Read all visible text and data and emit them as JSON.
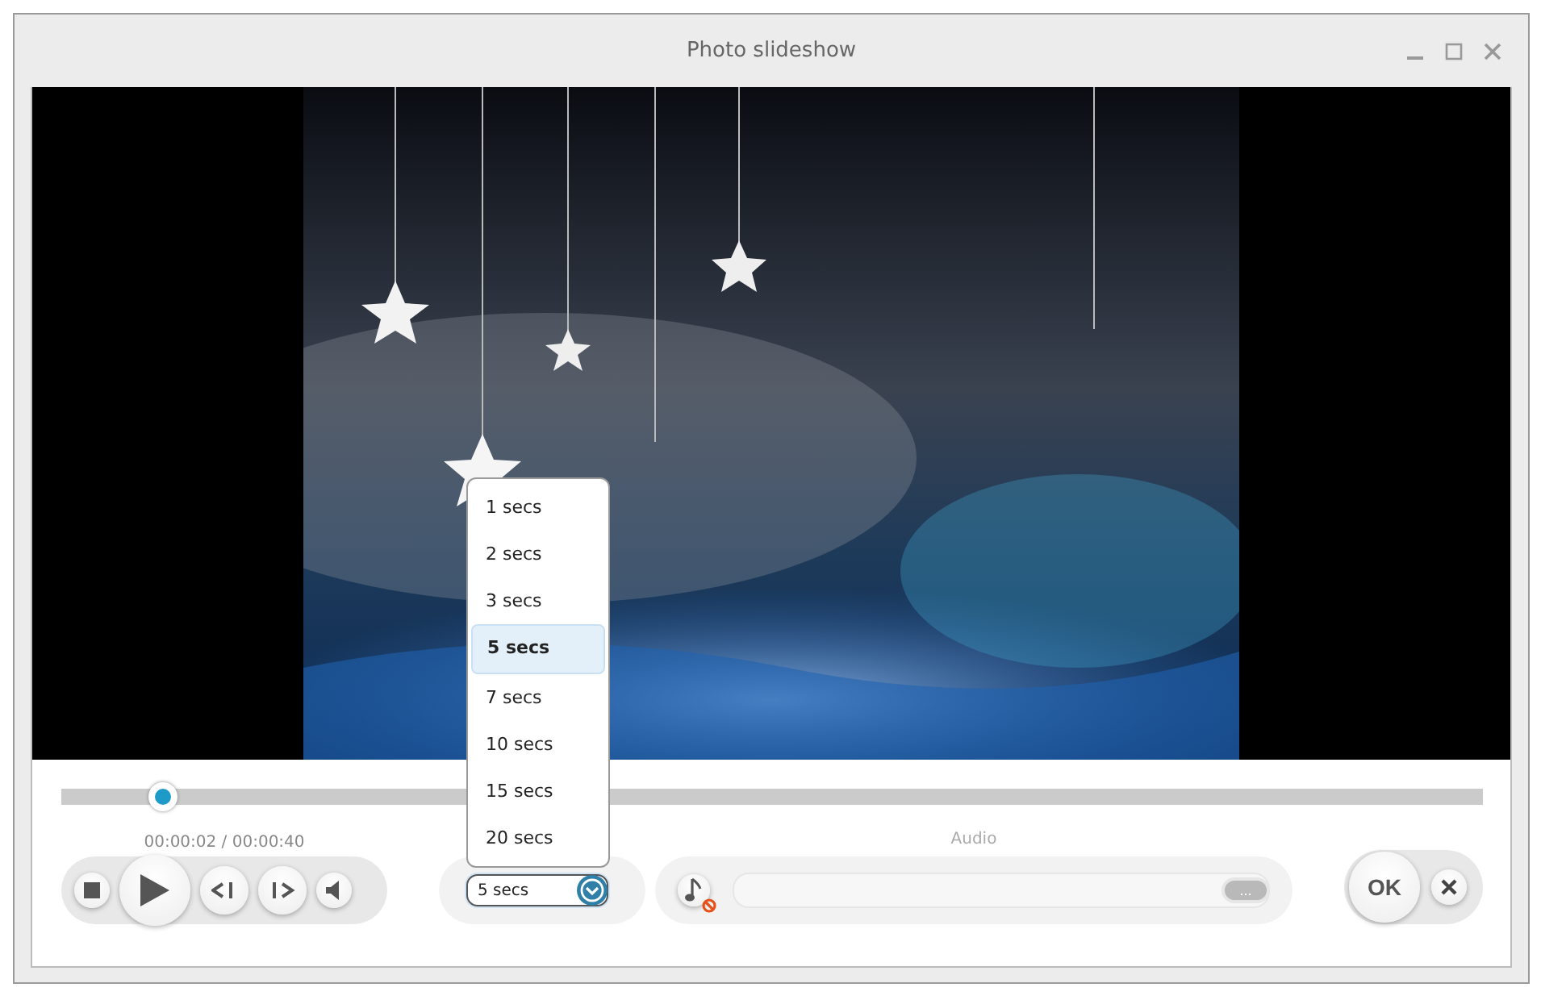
{
  "window": {
    "title": "Photo slideshow"
  },
  "playback": {
    "level": 0.07,
    "time": "00:00:02 / 00:00:40"
  },
  "duration": {
    "value": "5 secs",
    "expanded": true,
    "options": [
      {
        "label": "1 secs",
        "selected": false
      },
      {
        "label": "2 secs",
        "selected": false
      },
      {
        "label": "3 secs",
        "selected": false
      },
      {
        "label": "5 secs",
        "selected": true
      },
      {
        "label": "7 secs",
        "selected": false
      },
      {
        "label": "10 secs",
        "selected": false
      },
      {
        "label": "15 secs",
        "selected": false
      },
      {
        "label": "20 secs",
        "selected": false
      }
    ]
  },
  "audio": {
    "label": "Audio",
    "muted": true,
    "browse": "..."
  },
  "ok": "OK"
}
